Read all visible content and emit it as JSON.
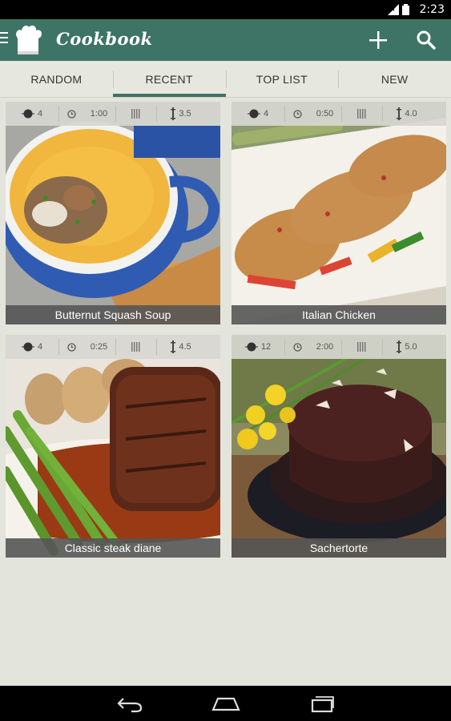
{
  "status_bar": {
    "time": "2:23"
  },
  "app_bar": {
    "title": "Cookbook"
  },
  "tabs": [
    {
      "label": "RANDOM",
      "active": false
    },
    {
      "label": "RECENT",
      "active": true
    },
    {
      "label": "TOP LIST",
      "active": false
    },
    {
      "label": "NEW",
      "active": false
    }
  ],
  "recipes": [
    {
      "name": "Butternut Squash Soup",
      "servings": "4",
      "time": "1:00",
      "rating": "3.5"
    },
    {
      "name": "Italian Chicken",
      "servings": "4",
      "time": "0:50",
      "rating": "4.0"
    },
    {
      "name": "Classic steak diane",
      "servings": "4",
      "time": "0:25",
      "rating": "4.5"
    },
    {
      "name": "Sachertorte",
      "servings": "12",
      "time": "2:00",
      "rating": "5.0"
    }
  ],
  "colors": {
    "primary": "#3e7465",
    "background": "#e3e4db",
    "caption": "#555555"
  }
}
